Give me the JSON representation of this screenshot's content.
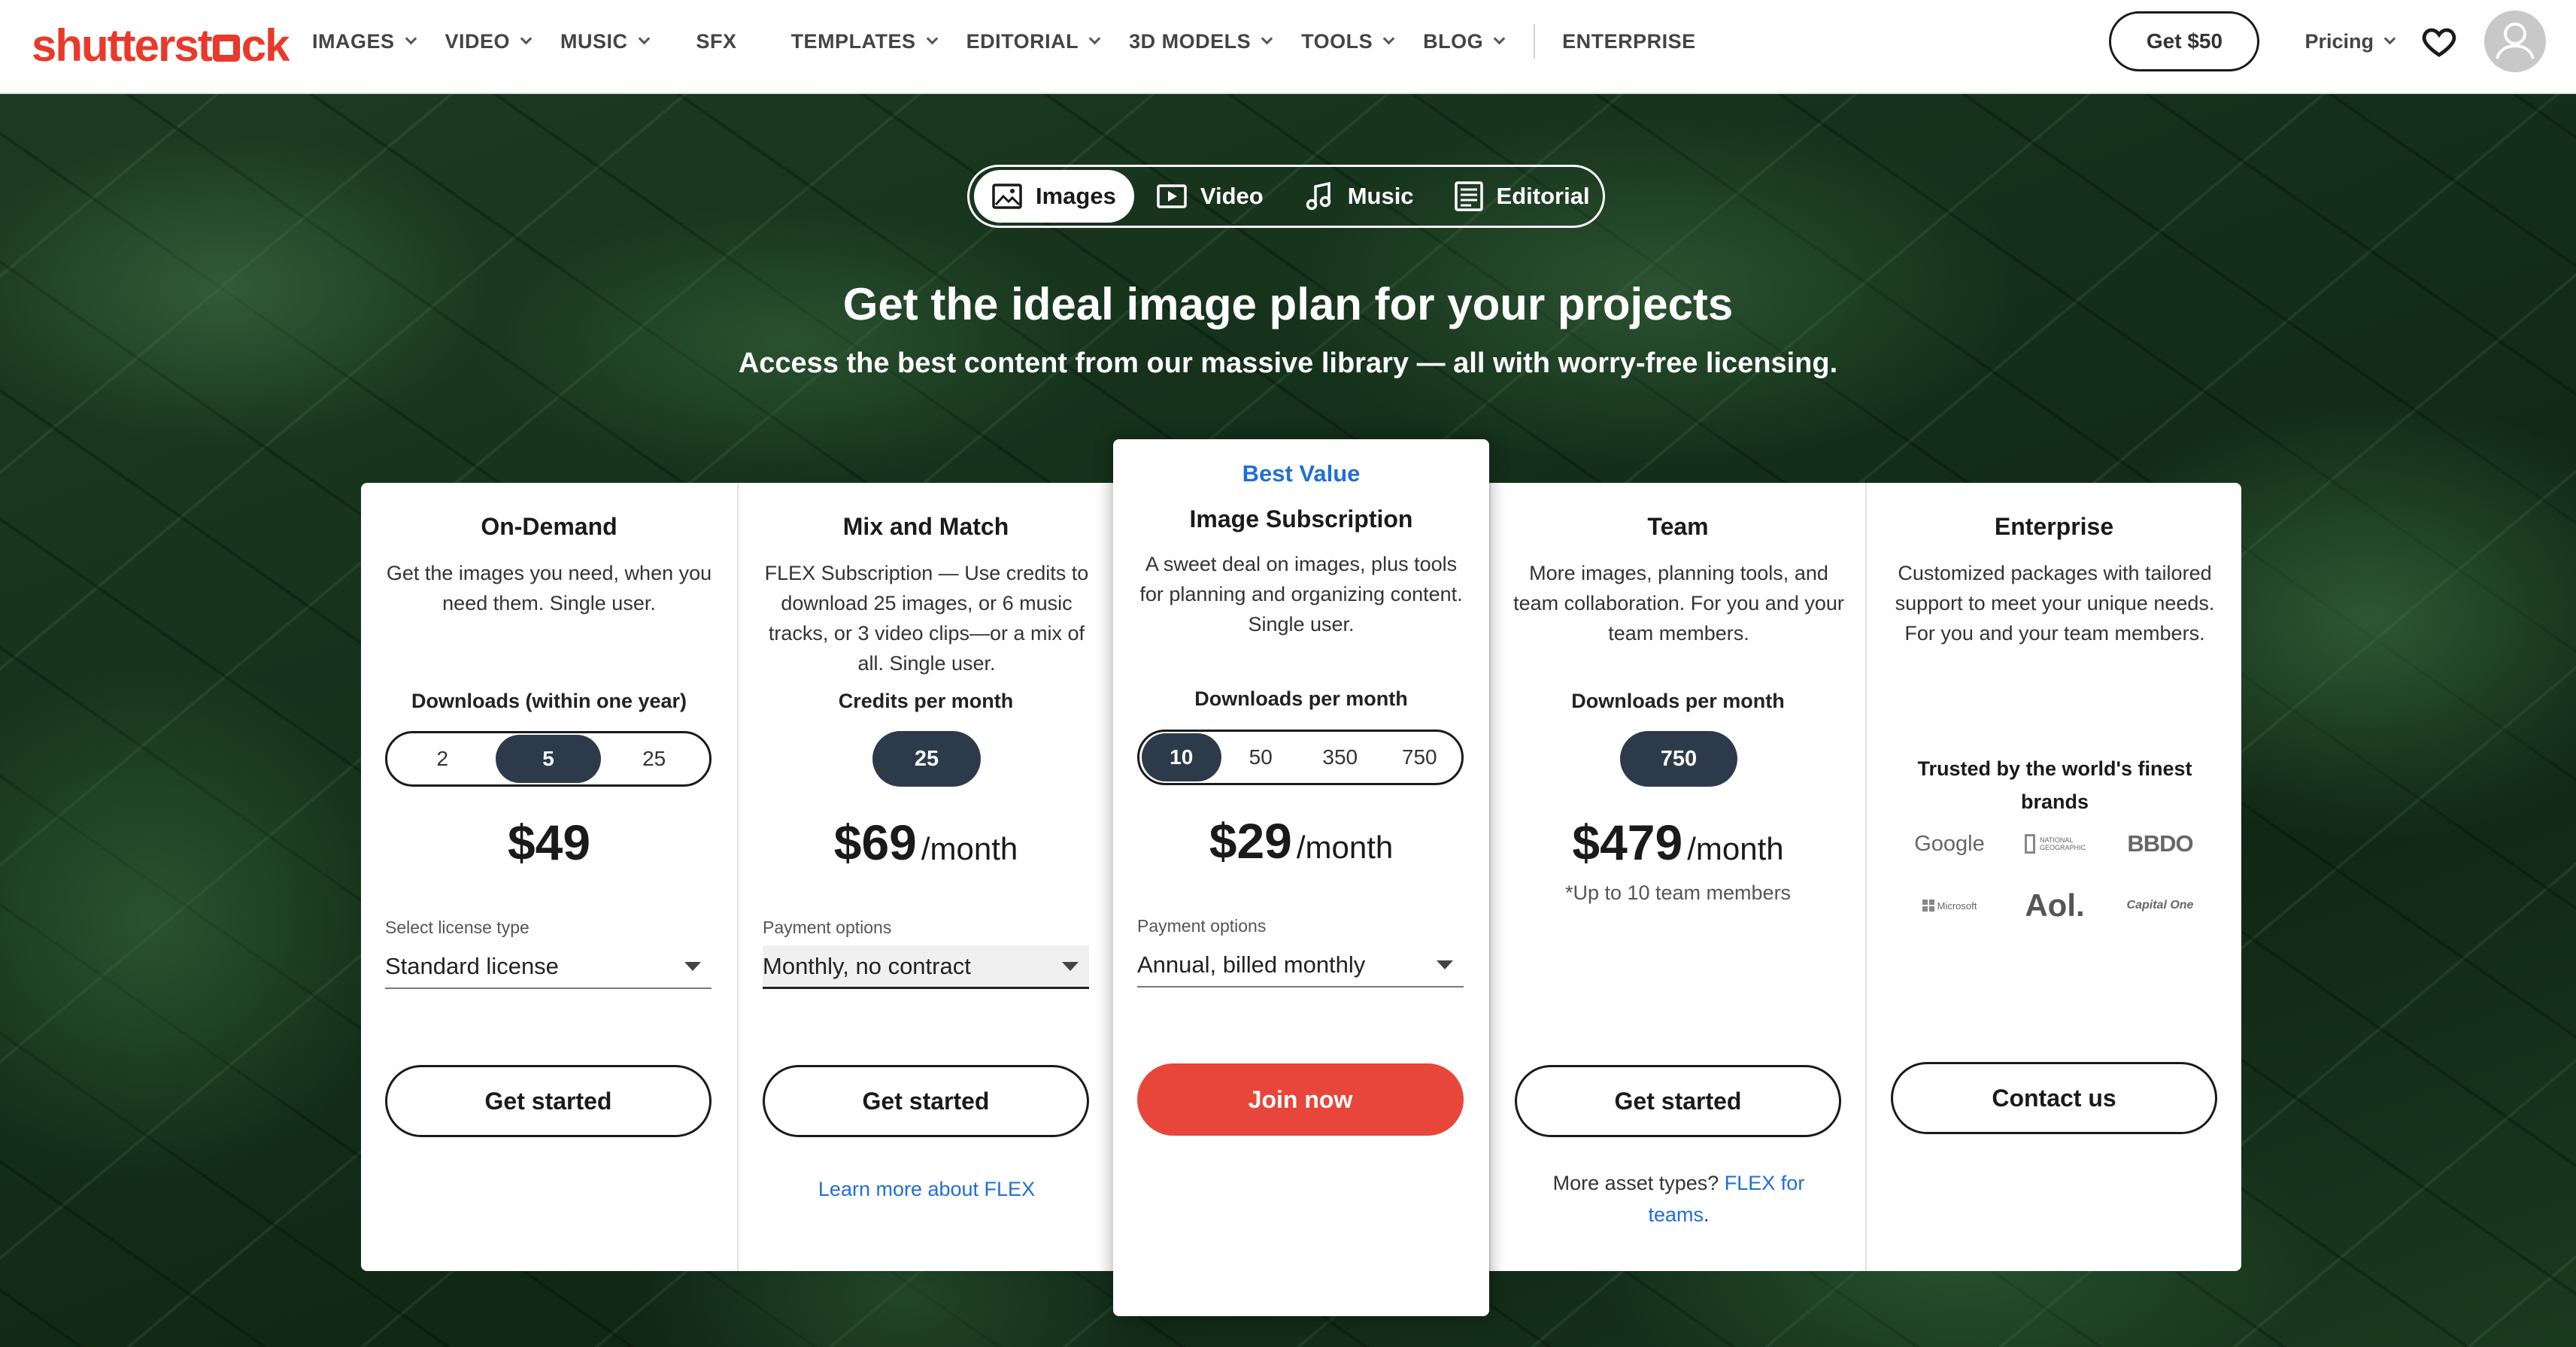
{
  "nav": {
    "logo": {
      "pre": "shutterst",
      "post": "ck"
    },
    "items": [
      {
        "label": "IMAGES",
        "dropdown": true
      },
      {
        "label": "VIDEO",
        "dropdown": true
      },
      {
        "label": "MUSIC",
        "dropdown": true
      },
      {
        "label": "SFX",
        "dropdown": false
      },
      {
        "label": "TEMPLATES",
        "dropdown": true
      },
      {
        "label": "EDITORIAL",
        "dropdown": true
      },
      {
        "label": "3D MODELS",
        "dropdown": true
      },
      {
        "label": "TOOLS",
        "dropdown": true
      },
      {
        "label": "BLOG",
        "dropdown": true
      },
      {
        "label": "ENTERPRISE",
        "dropdown": false
      }
    ],
    "cta": "Get $50",
    "pricing": "Pricing"
  },
  "content_tabs": [
    {
      "label": "Images",
      "icon": "image-icon",
      "active": true
    },
    {
      "label": "Video",
      "icon": "video-icon",
      "active": false
    },
    {
      "label": "Music",
      "icon": "music-note-icon",
      "active": false
    },
    {
      "label": "Editorial",
      "icon": "editorial-icon",
      "active": false
    }
  ],
  "hero": {
    "title": "Get the ideal image plan for your projects",
    "subtitle": "Access the best content from our massive library — all with worry-free licensing."
  },
  "plans": {
    "on_demand": {
      "name": "On-Demand",
      "desc": "Get the images you need, when you need them. Single user.",
      "selector_label": "Downloads (within one year)",
      "options": [
        "2",
        "5",
        "25"
      ],
      "selected": "5",
      "price": "$49",
      "select_label": "Select license type",
      "select_value": "Standard license",
      "button": "Get started"
    },
    "mix_match": {
      "name": "Mix and Match",
      "desc": "FLEX Subscription — Use credits to download 25 images, or 6 music tracks, or 3 video clips—or a mix of all. Single user.",
      "selector_label": "Credits per month",
      "selected": "25",
      "price": "$69",
      "per": "/month",
      "select_label": "Payment options",
      "select_value": "Monthly, no contract",
      "button": "Get started",
      "link": "Learn more about FLEX"
    },
    "subscription": {
      "badge": "Best Value",
      "name": "Image Subscription",
      "desc": "A sweet deal on images, plus tools for planning and organizing content. Single user.",
      "selector_label": "Downloads per month",
      "options": [
        "10",
        "50",
        "350",
        "750"
      ],
      "selected": "10",
      "price": "$29",
      "per": "/month",
      "select_label": "Payment options",
      "select_value": "Annual, billed monthly",
      "button": "Join now"
    },
    "team": {
      "name": "Team",
      "desc": "More images, planning tools, and team collaboration. For you and your team members.",
      "selector_label": "Downloads per month",
      "selected": "750",
      "price": "$479",
      "per": "/month",
      "note": "*Up to 10 team members",
      "button": "Get started",
      "more_text": "More asset types?",
      "more_link": "FLEX for teams",
      "more_end": "."
    },
    "enterprise": {
      "name": "Enterprise",
      "desc": "Customized packages with tailored support to meet your unique needs. For you and your team members.",
      "trusted": "Trusted by the world's finest brands",
      "brands": [
        "Google",
        "NATIONAL GEOGRAPHIC",
        "BBDO",
        "Microsoft",
        "Aol.",
        "Capital One"
      ],
      "button": "Contact us"
    }
  },
  "colors": {
    "brand_red": "#e8392b",
    "cta_red": "#e8463a",
    "link_blue": "#1f6fd6",
    "selected_dark": "#2d3a4a"
  }
}
